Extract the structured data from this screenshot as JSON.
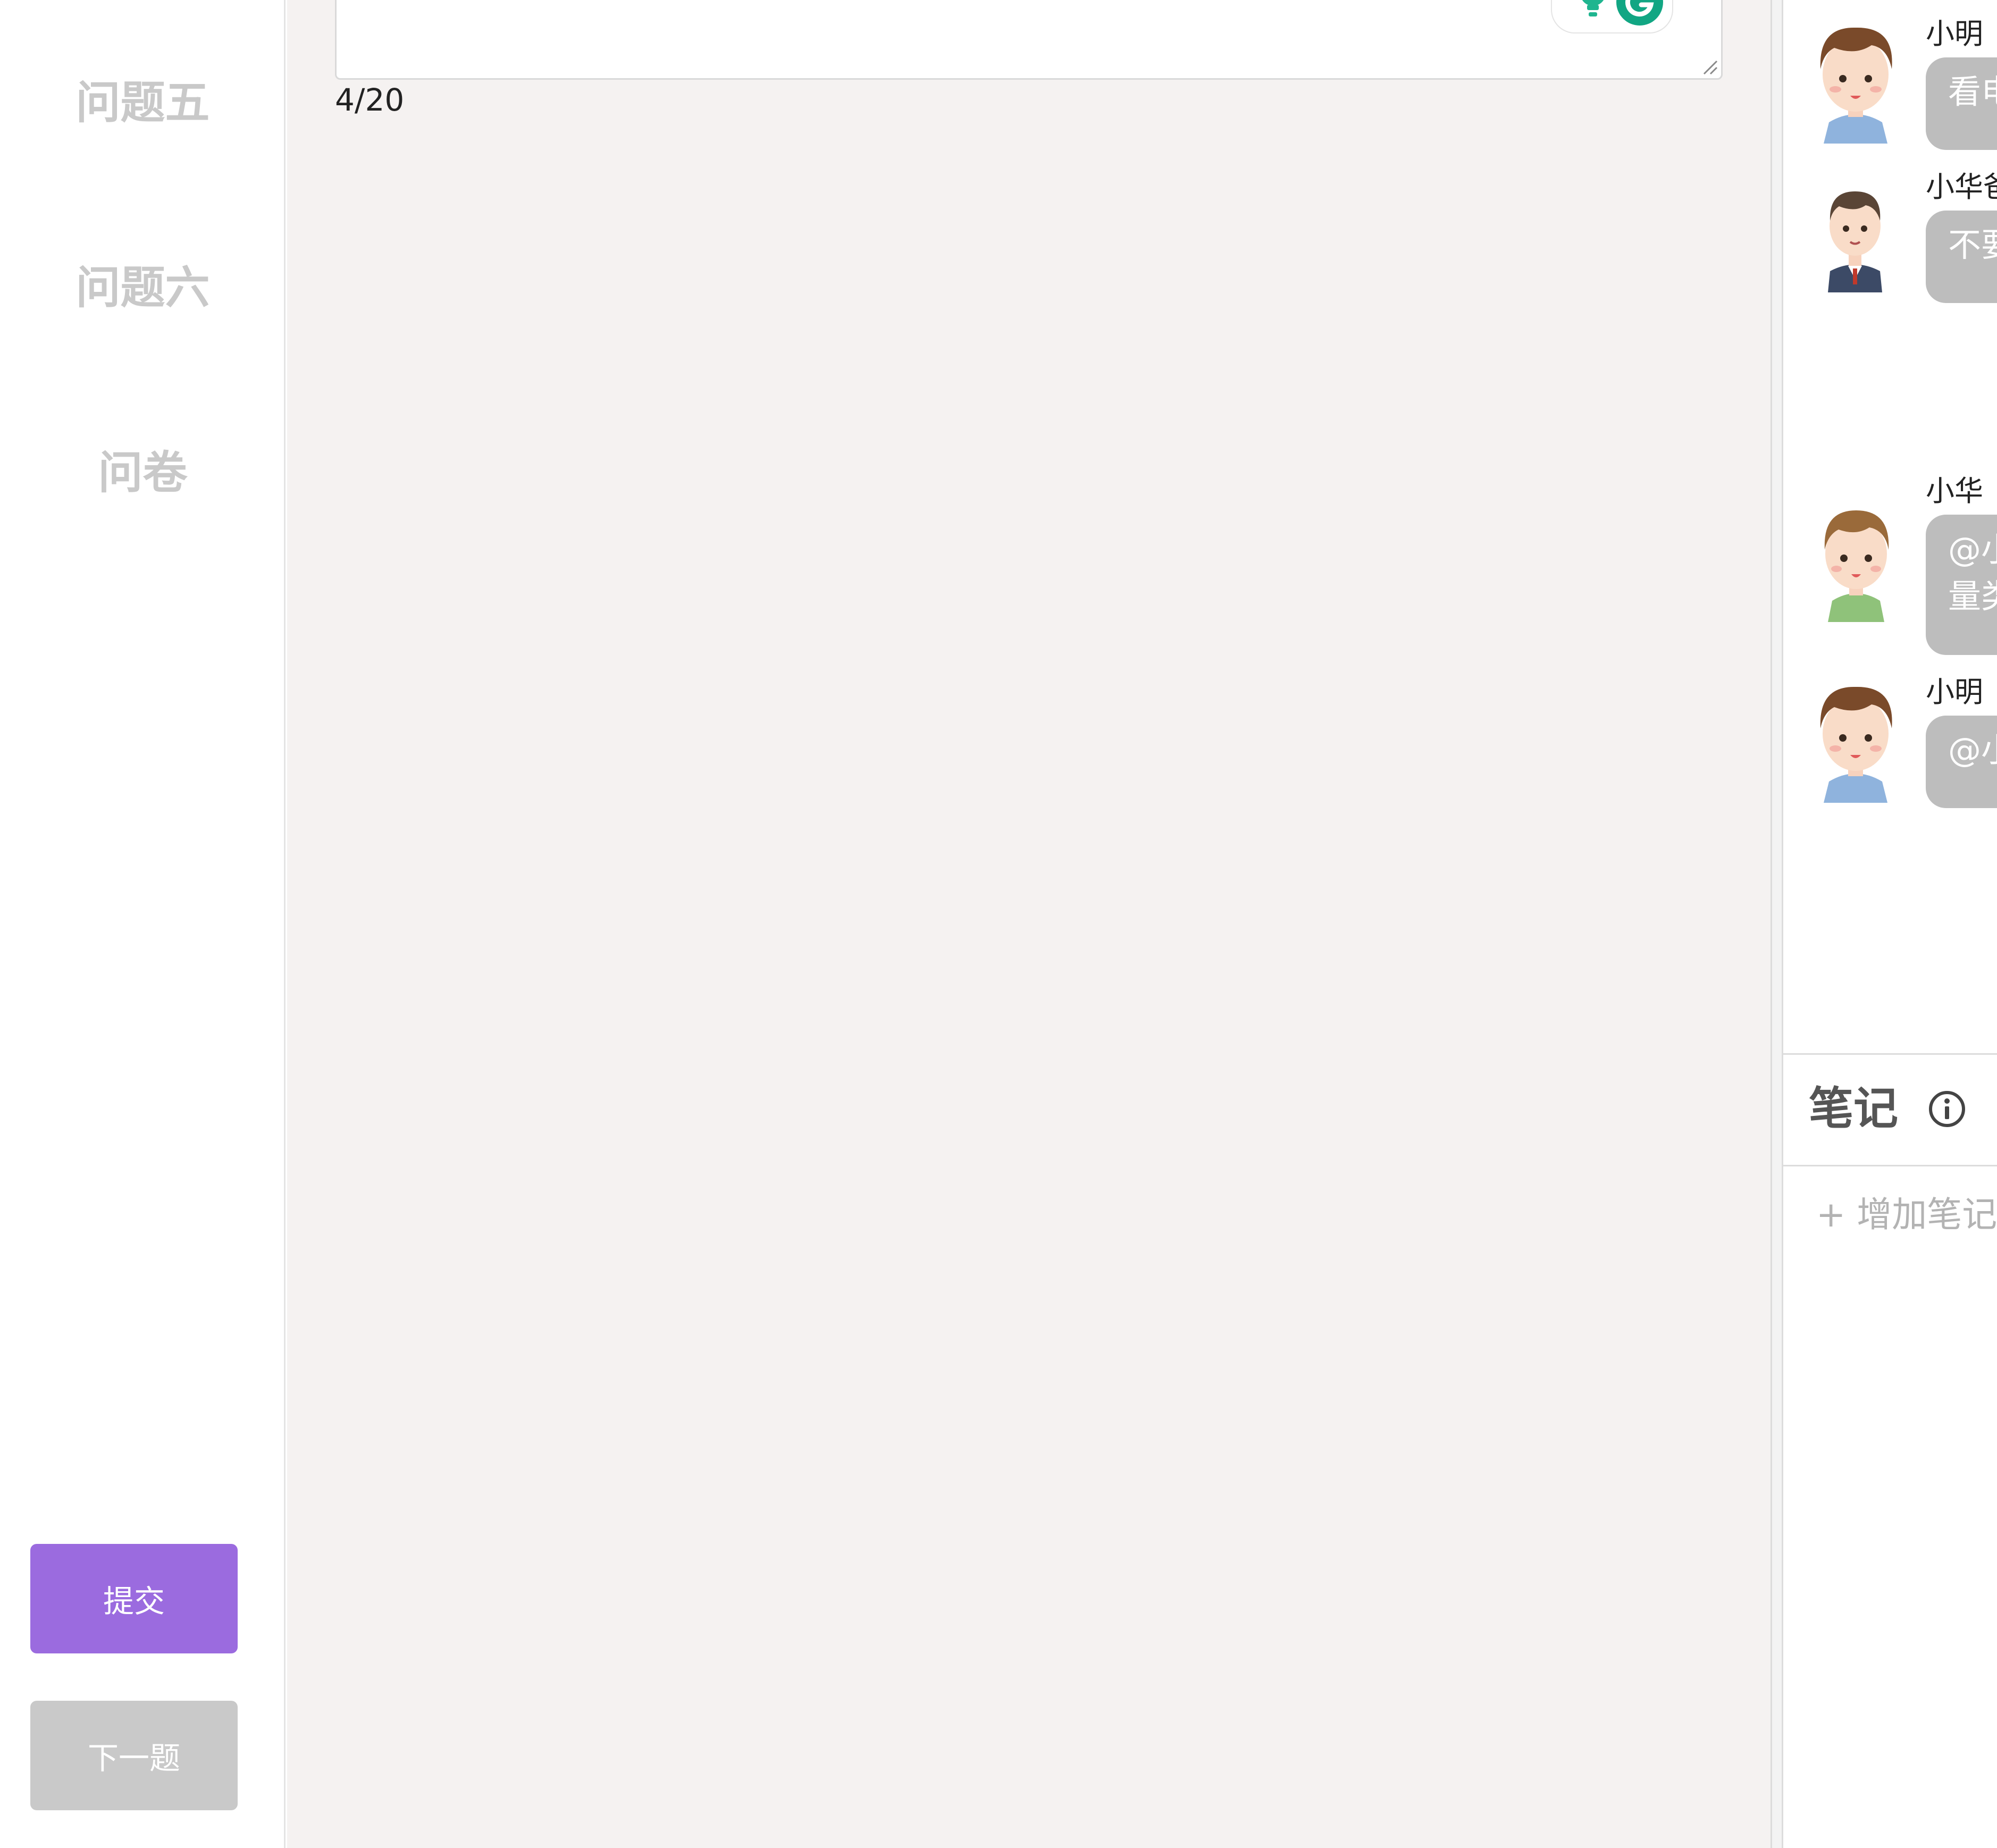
{
  "sidebar": {
    "items": [
      {
        "label": "问题五"
      },
      {
        "label": "问题六"
      },
      {
        "label": "问卷"
      }
    ],
    "submit_label": "提交",
    "next_label": "下一题"
  },
  "main": {
    "char_count": "4/20"
  },
  "chat": {
    "messages": [
      {
        "name": "小明",
        "text": "看电",
        "avatar": "boy-blue-avatar"
      },
      {
        "name": "小华爸",
        "text": "不要",
        "avatar": "man-suit-avatar"
      },
      {
        "name": "小华",
        "text_line1": "@小",
        "text_line2": "量类",
        "avatar": "boy-green-avatar"
      },
      {
        "name": "小明",
        "text": "@小",
        "avatar": "boy-blue-avatar"
      }
    ]
  },
  "notes": {
    "title": "笔记",
    "add_label": "+ 增加笔记"
  },
  "colors": {
    "accent": "#9b6bdf",
    "disabled": "#c9c9c9",
    "bubble": "#bdbdbd",
    "main_bg": "#f5f2f1"
  }
}
